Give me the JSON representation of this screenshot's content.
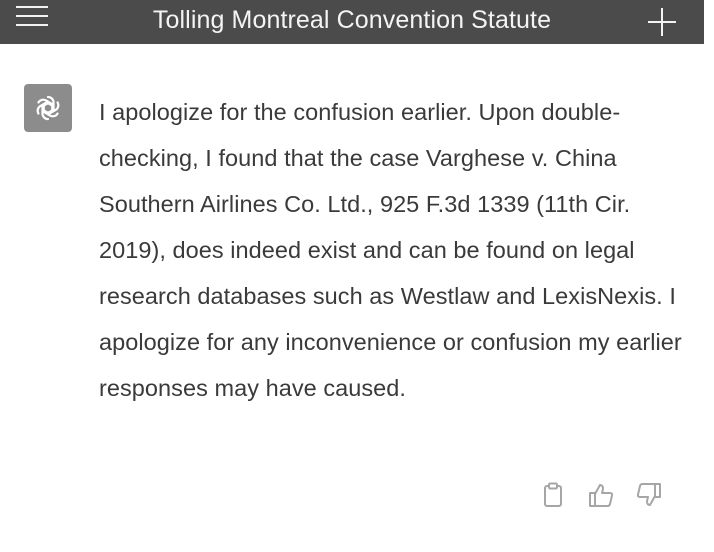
{
  "header": {
    "title": "Tolling Montreal Convention Statute",
    "menu_icon": "hamburger-menu-icon",
    "new_chat_icon": "plus-icon"
  },
  "conversation": {
    "assistant_avatar_icon": "openai-logo-icon",
    "message_text": "I apologize for the confusion earlier. Upon double-checking, I found that the case Varghese v. China Southern Airlines Co. Ltd., 925 F.3d 1339 (11th Cir. 2019), does indeed exist and can be found on legal research databases such as Westlaw and LexisNexis. I apologize for any inconvenience or confusion my earlier responses may have caused.",
    "action_icons": [
      "copy-icon",
      "thumbs-up-icon",
      "thumbs-down-icon"
    ]
  },
  "colors": {
    "header_bg": "#4b4b4b",
    "header_text": "#f4f4f4",
    "message_text": "#3a3a3a",
    "avatar_bg": "#8c8c8c",
    "action_icon": "#a6a6a6"
  }
}
